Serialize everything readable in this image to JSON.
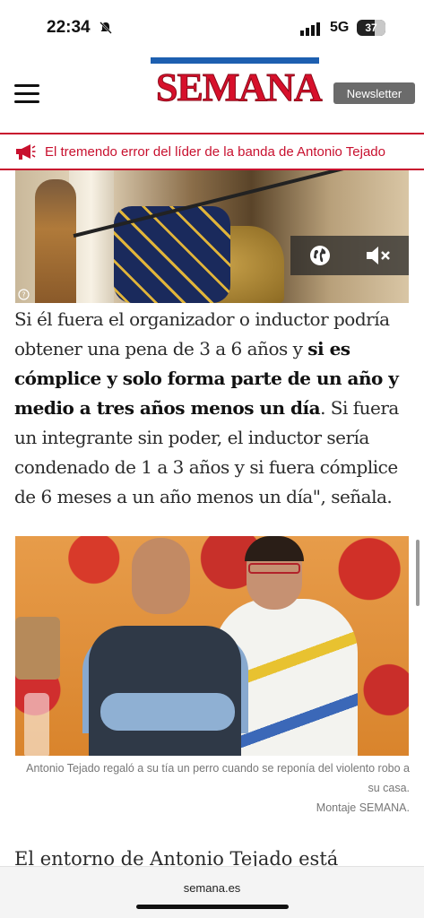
{
  "status_bar": {
    "time": "22:34",
    "network": "5G",
    "battery": "37"
  },
  "header": {
    "logo": "SEMANA",
    "newsletter_label": "Newsletter"
  },
  "breaking": {
    "text": "El tremendo error del líder de la banda de Antonio Tejado"
  },
  "article": {
    "p1_a": "Si él fuera el organizador o inductor podría obtener una pena de 3 a 6 años y ",
    "p1_bold": "si es cómplice y solo forma parte de un año y medio a tres años menos un día",
    "p1_b": ". Si fuera un integrante sin poder, el inductor sería condenado de 1 a 3 años y si fuera cómplice de 6 meses a un año menos un día\", señala.",
    "image_caption": "Antonio Tejado regaló a su tía un perro cuando se reponía del violento robo a su casa.",
    "image_credit": "Montaje SEMANA.",
    "next_heading": "El entorno de Antonio Tejado está"
  },
  "browser": {
    "url": "semana.es"
  },
  "colors": {
    "brand_red": "#c8102e",
    "brand_blue": "#1d5fb0"
  },
  "icons": [
    "bell-muted-icon",
    "signal-icon",
    "menu-icon",
    "megaphone-icon",
    "globe-icon",
    "mute-icon",
    "info-icon"
  ]
}
